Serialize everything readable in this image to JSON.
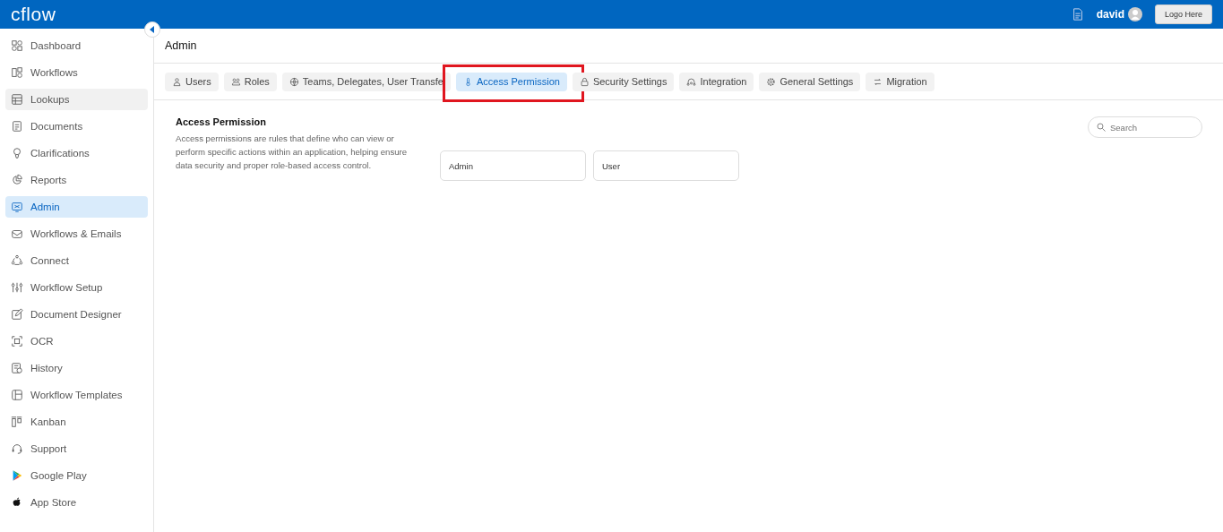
{
  "header": {
    "logo": "cflow",
    "user": "david",
    "logo_button": "Logo Here"
  },
  "sidebar": {
    "items": [
      {
        "label": "Dashboard",
        "selected": false,
        "hovered": false
      },
      {
        "label": "Workflows",
        "selected": false,
        "hovered": false
      },
      {
        "label": "Lookups",
        "selected": false,
        "hovered": true
      },
      {
        "label": "Documents",
        "selected": false,
        "hovered": false
      },
      {
        "label": "Clarifications",
        "selected": false,
        "hovered": false
      },
      {
        "label": "Reports",
        "selected": false,
        "hovered": false
      },
      {
        "label": "Admin",
        "selected": true,
        "hovered": false
      },
      {
        "label": "Workflows & Emails",
        "selected": false,
        "hovered": false
      },
      {
        "label": "Connect",
        "selected": false,
        "hovered": false
      },
      {
        "label": "Workflow Setup",
        "selected": false,
        "hovered": false
      },
      {
        "label": "Document Designer",
        "selected": false,
        "hovered": false
      },
      {
        "label": "OCR",
        "selected": false,
        "hovered": false
      },
      {
        "label": "History",
        "selected": false,
        "hovered": false
      },
      {
        "label": "Workflow Templates",
        "selected": false,
        "hovered": false
      },
      {
        "label": "Kanban",
        "selected": false,
        "hovered": false
      },
      {
        "label": "Support",
        "selected": false,
        "hovered": false
      },
      {
        "label": "Google Play",
        "selected": false,
        "hovered": false
      },
      {
        "label": "App Store",
        "selected": false,
        "hovered": false
      }
    ]
  },
  "page_title": "Admin",
  "tabs": [
    {
      "label": "Users",
      "selected": false
    },
    {
      "label": "Roles",
      "selected": false
    },
    {
      "label": "Teams, Delegates, User Transfe",
      "selected": false
    },
    {
      "label": "Access Permission",
      "selected": true
    },
    {
      "label": "Security Settings",
      "selected": false
    },
    {
      "label": "Integration",
      "selected": false
    },
    {
      "label": "General Settings",
      "selected": false
    },
    {
      "label": "Migration",
      "selected": false
    }
  ],
  "section": {
    "title": "Access Permission",
    "description": "Access permissions are rules that define who can view or perform specific actions within an application, helping ensure data security and proper role-based access control.",
    "fields": [
      {
        "value": "Admin"
      },
      {
        "value": "User"
      }
    ],
    "search": {
      "placeholder": "Search"
    }
  }
}
